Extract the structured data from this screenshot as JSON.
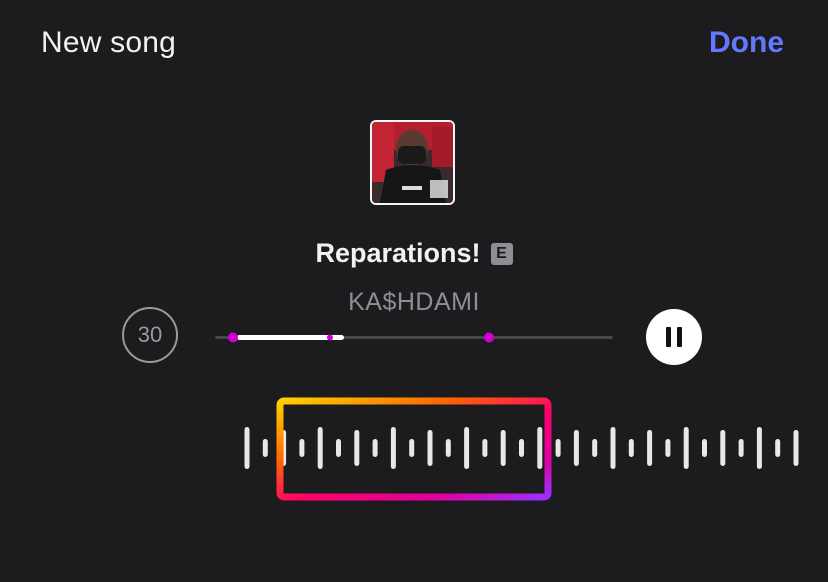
{
  "header": {
    "title": "New song",
    "done_label": "Done"
  },
  "track": {
    "title": "Reparations!",
    "explicit_badge": "E",
    "artist": "KA$HDAMI"
  },
  "player": {
    "clip_duration": "30",
    "progress_fraction": 0.27,
    "state": "playing"
  },
  "colors": {
    "background": "#1c1c1e",
    "accent": "#6478ff",
    "progress_marker": "#d000d0",
    "selector_gradient": [
      "#ffd000",
      "#ff6a00",
      "#ff0066",
      "#e000a0",
      "#9b30ff"
    ]
  },
  "icons": {
    "pause": "pause-icon"
  }
}
